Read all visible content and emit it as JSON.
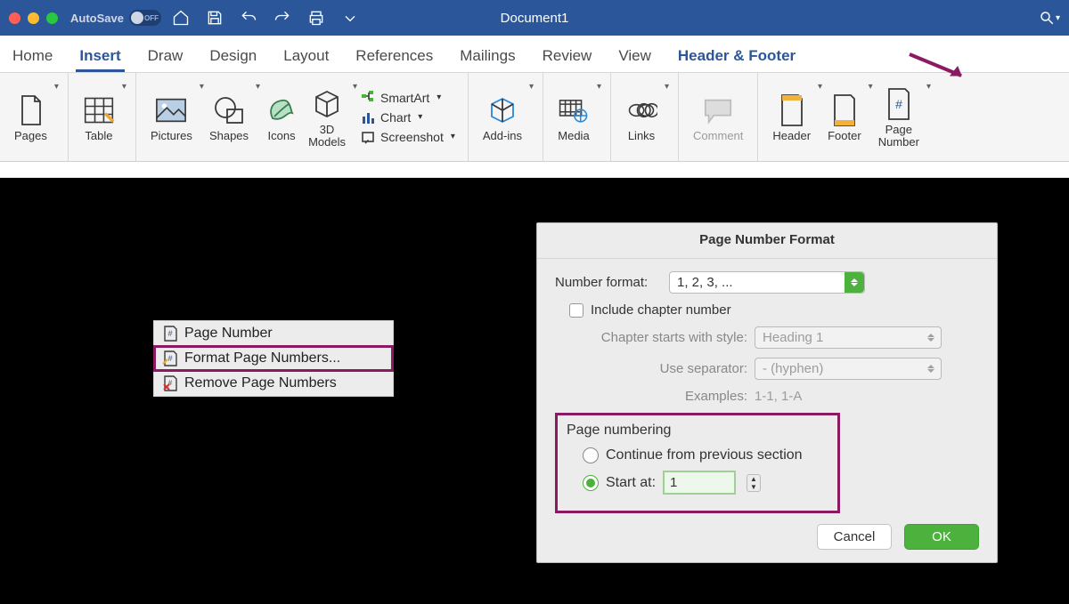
{
  "titlebar": {
    "autosave_label": "AutoSave",
    "autosave_state": "OFF",
    "document_title": "Document1"
  },
  "tabs": {
    "items": [
      "Home",
      "Insert",
      "Draw",
      "Design",
      "Layout",
      "References",
      "Mailings",
      "Review",
      "View"
    ],
    "active_index": 1,
    "contextual": "Header & Footer"
  },
  "ribbon": {
    "pages": "Pages",
    "table": "Table",
    "pictures": "Pictures",
    "shapes": "Shapes",
    "icons": "Icons",
    "models": "3D\nModels",
    "smartart": "SmartArt",
    "chart": "Chart",
    "screenshot": "Screenshot",
    "addins": "Add-ins",
    "media": "Media",
    "links": "Links",
    "comment": "Comment",
    "header": "Header",
    "footer": "Footer",
    "page_number": "Page\nNumber"
  },
  "context_menu": {
    "items": [
      {
        "label": "Page Number",
        "icon": "page-number-icon"
      },
      {
        "label": "Format Page Numbers...",
        "icon": "format-page-numbers-icon"
      },
      {
        "label": "Remove Page Numbers",
        "icon": "remove-page-numbers-icon"
      }
    ],
    "highlighted_index": 1
  },
  "dialog": {
    "title": "Page Number Format",
    "number_format_label": "Number format:",
    "number_format_value": "1, 2, 3, ...",
    "include_chapter_label": "Include chapter number",
    "chapter_style_label": "Chapter starts with style:",
    "chapter_style_value": "Heading 1",
    "separator_label": "Use separator:",
    "separator_value": "-    (hyphen)",
    "examples_label": "Examples:",
    "examples_value": "1-1, 1-A",
    "section_title": "Page numbering",
    "radio_continue": "Continue from previous section",
    "radio_start": "Start at:",
    "start_value": "1",
    "cancel": "Cancel",
    "ok": "OK"
  }
}
